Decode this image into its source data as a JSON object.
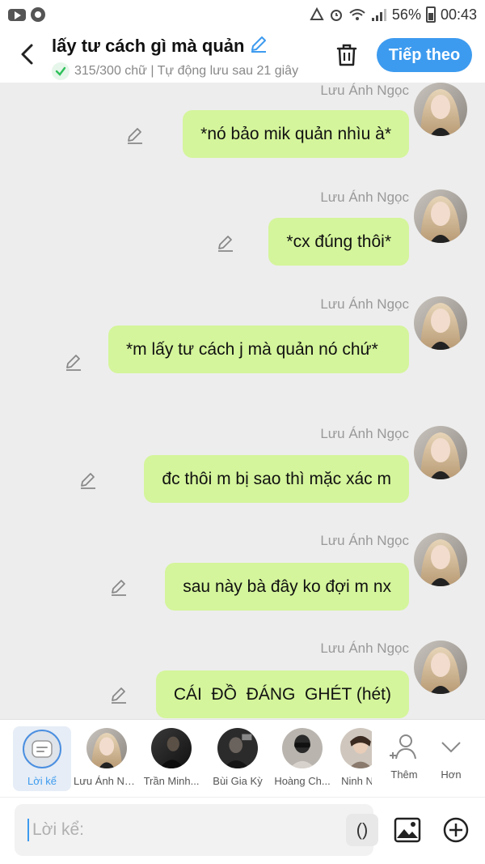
{
  "status_bar": {
    "battery": "56%",
    "time": "00:43"
  },
  "header": {
    "title": "lấy tư cách gì mà quản",
    "subtitle": "315/300 chữ | Tự động lưu sau 21 giây",
    "next_label": "Tiếp theo"
  },
  "messages": [
    {
      "sender": "Lưu Ánh Ngọc",
      "text": "*nó bảo mik quản nhìu à*"
    },
    {
      "sender": "Lưu Ánh Ngọc",
      "text": "*cx đúng thôi*"
    },
    {
      "sender": "Lưu Ánh Ngọc",
      "text": "*m lấy tư cách j mà quản nó chứ*"
    },
    {
      "sender": "Lưu Ánh Ngọc",
      "text": "đc thôi m bị sao thì mặc xác m"
    },
    {
      "sender": "Lưu Ánh Ngọc",
      "text": "sau này bà đây ko đợi m nx"
    },
    {
      "sender": "Lưu Ánh Ngọc",
      "text": "CÁI  ĐỒ  ĐÁNG  GHÉT (hét)"
    }
  ],
  "characters": [
    {
      "name": "Lời kể",
      "selected": true
    },
    {
      "name": "Lưu Ánh Ngọc"
    },
    {
      "name": "Trần Minh..."
    },
    {
      "name": "Bùi Gia Kỳ"
    },
    {
      "name": "Hoàng Ch..."
    },
    {
      "name": "Ninh N"
    }
  ],
  "actions": {
    "add_label": "Thêm",
    "more_label": "Hơn"
  },
  "input": {
    "placeholder": "Lời kể:",
    "paren_label": "()"
  },
  "colors": {
    "accent": "#3d9bef",
    "bubble": "#d4f59b",
    "background": "#ededed"
  }
}
